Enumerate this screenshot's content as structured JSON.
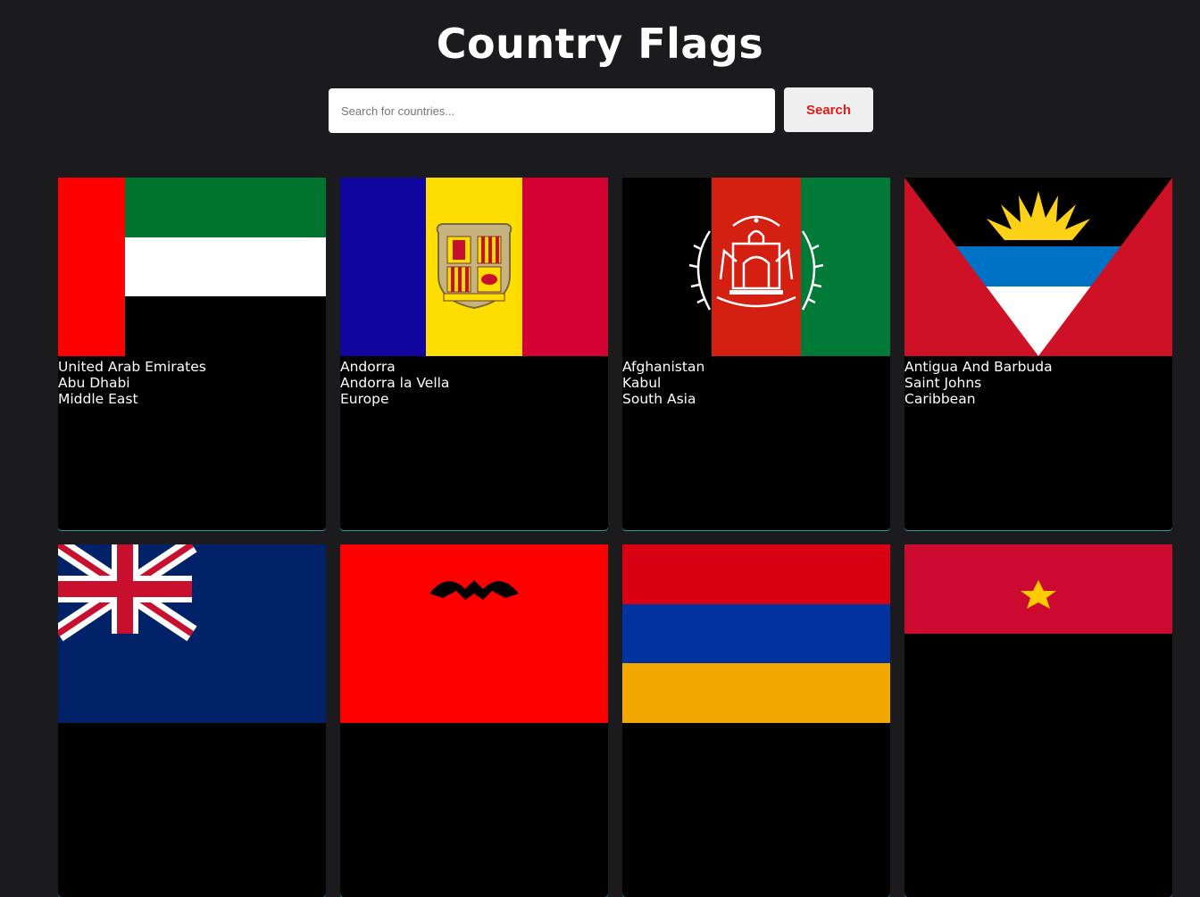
{
  "header": {
    "title": "Country Flags"
  },
  "search": {
    "placeholder": "Search for countries...",
    "button_label": "Search"
  },
  "countries": [
    {
      "name": "United Arab Emirates",
      "capital": "Abu Dhabi",
      "region": "Middle East",
      "flag_icon": "uae-flag"
    },
    {
      "name": "Andorra",
      "capital": "Andorra la Vella",
      "region": "Europe",
      "flag_icon": "andorra-flag"
    },
    {
      "name": "Afghanistan",
      "capital": "Kabul",
      "region": "South Asia",
      "flag_icon": "afghanistan-flag"
    },
    {
      "name": "Antigua And Barbuda",
      "capital": "Saint Johns",
      "region": "Caribbean",
      "flag_icon": "antigua-flag"
    },
    {
      "name": "",
      "capital": "",
      "region": "",
      "flag_icon": "anguilla-flag"
    },
    {
      "name": "",
      "capital": "",
      "region": "",
      "flag_icon": "albania-flag"
    },
    {
      "name": "",
      "capital": "",
      "region": "",
      "flag_icon": "armenia-flag"
    },
    {
      "name": "",
      "capital": "",
      "region": "",
      "flag_icon": "angola-flag"
    }
  ],
  "colors": {
    "background": "#1b1b1d",
    "card": "#000000",
    "search_text": "#e01b1b"
  }
}
